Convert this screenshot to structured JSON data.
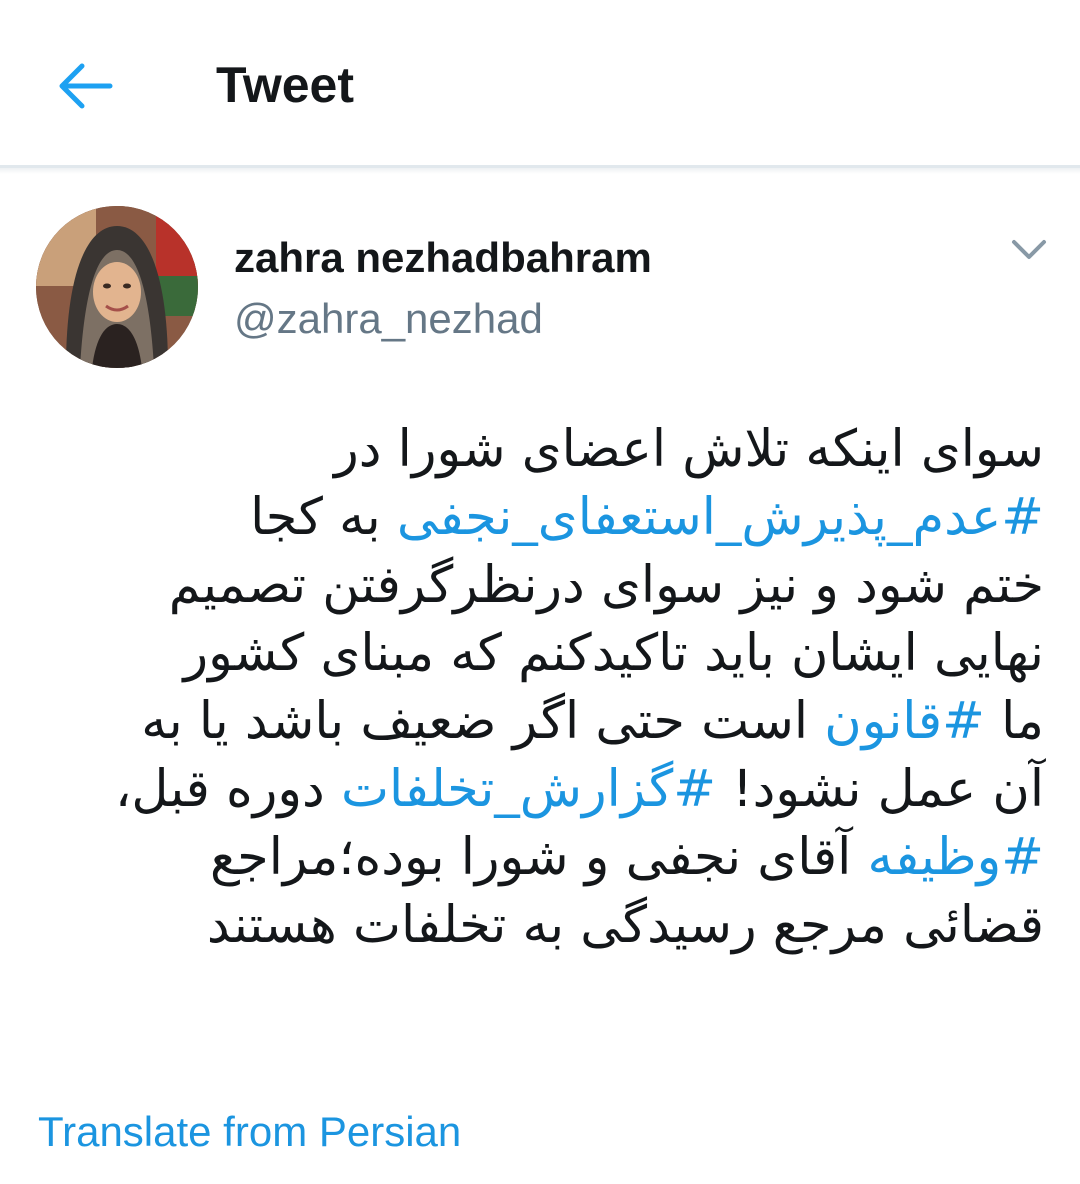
{
  "header": {
    "title": "Tweet",
    "back_icon": "arrow-left-icon"
  },
  "author": {
    "name": "zahra nezhadbahram",
    "handle": "@zahra_nezhad"
  },
  "tweet": {
    "lines": [
      [
        {
          "text": "سوای اینکه تلاش اعضای شورا در",
          "hashtag": false
        }
      ],
      [
        {
          "text": "#عدم_پذیرش_استعفای_نجفی",
          "hashtag": true
        },
        {
          "text": " به کجا",
          "hashtag": false
        }
      ],
      [
        {
          "text": "ختم شود و نیز سوای درنظرگرفتن تصمیم",
          "hashtag": false
        }
      ],
      [
        {
          "text": "نهایی ایشان باید تاکیدکنم که مبنای کشور",
          "hashtag": false
        }
      ],
      [
        {
          "text": "ما ",
          "hashtag": false
        },
        {
          "text": "#قانون",
          "hashtag": true
        },
        {
          "text": " است حتی اگر ضعیف باشد یا به",
          "hashtag": false
        }
      ],
      [
        {
          "text": "آن عمل نشود! ",
          "hashtag": false
        },
        {
          "text": "#گزارش_تخلفات",
          "hashtag": true
        },
        {
          "text": " دوره قبل،",
          "hashtag": false
        }
      ],
      [
        {
          "text": "#وظیفه",
          "hashtag": true
        },
        {
          "text": " آقای نجفی و شورا بوده؛مراجع",
          "hashtag": false
        }
      ],
      [
        {
          "text": "قضائی مرجع رسیدگی به تخلفات هستند",
          "hashtag": false
        }
      ]
    ]
  },
  "translate": {
    "label": "Translate from Persian"
  },
  "colors": {
    "accent": "#1b95e0",
    "text": "#14171a",
    "secondary": "#657786",
    "divider": "#e1e8ed"
  }
}
